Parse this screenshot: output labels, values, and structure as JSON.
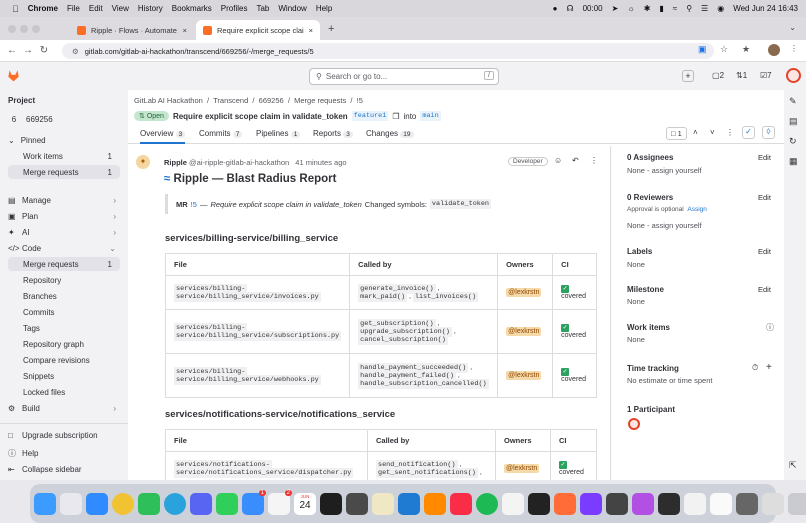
{
  "mac": {
    "app": "Chrome",
    "menus": [
      "File",
      "Edit",
      "View",
      "History",
      "Bookmarks",
      "Profiles",
      "Tab",
      "Window",
      "Help"
    ],
    "timer": "00:00",
    "datetime": "Wed Jun 24  16:43"
  },
  "tabs": [
    {
      "title": "Ripple · Flows · Automate · Gi"
    },
    {
      "title": "Require explicit scope claim"
    }
  ],
  "url": "gitlab.com/gitlab-ai-hackathon/transcend/669256/-/merge_requests/5",
  "topbar": {
    "search_placeholder": "Search or go to...",
    "slash": "/",
    "issues_count": "2",
    "mr_count": "1",
    "todo_count": "7"
  },
  "sidebar": {
    "project_heading": "Project",
    "project_avatar": "6",
    "project_name": "669256",
    "pinned": "Pinned",
    "pinned_items": [
      {
        "label": "Work items",
        "count": "1"
      },
      {
        "label": "Merge requests",
        "count": "1"
      }
    ],
    "sections": [
      "Manage",
      "Plan",
      "AI",
      "Code"
    ],
    "code_items": [
      {
        "label": "Merge requests",
        "count": "1"
      },
      {
        "label": "Repository"
      },
      {
        "label": "Branches"
      },
      {
        "label": "Commits"
      },
      {
        "label": "Tags"
      },
      {
        "label": "Repository graph"
      },
      {
        "label": "Compare revisions"
      },
      {
        "label": "Snippets"
      },
      {
        "label": "Locked files"
      }
    ],
    "build": "Build",
    "upgrade": "Upgrade subscription",
    "help": "Help",
    "collapse": "Collapse sidebar"
  },
  "breadcrumb": [
    "GitLab AI Hackathon",
    "Transcend",
    "669256",
    "Merge requests",
    "!5"
  ],
  "mr": {
    "status": "Open",
    "title": "Require explicit scope claim in validate_token",
    "source_branch": "feature1",
    "into": "into",
    "target_branch": "main",
    "tabs": [
      {
        "label": "Overview",
        "count": "3"
      },
      {
        "label": "Commits",
        "count": "7"
      },
      {
        "label": "Pipelines",
        "count": "1"
      },
      {
        "label": "Reports",
        "count": "3"
      },
      {
        "label": "Changes",
        "count": "19"
      }
    ],
    "comments_count": "1"
  },
  "note": {
    "author": "Ripple",
    "handle": "@ai-ripple-gitlab-ai-hackathon",
    "time": "41 minutes ago",
    "badge": "Developer",
    "heading": "Ripple — Blast Radius Report",
    "quote_mr": "MR",
    "quote_ref": "!5",
    "quote_dash": "—",
    "quote_title": "Require explicit scope claim in validate_token",
    "quote_changed": "Changed symbols:",
    "quote_symbol": "validate_token",
    "sections": [
      {
        "heading": "services/billing-service/billing_service",
        "columns": [
          "File",
          "Called by",
          "Owners",
          "CI"
        ],
        "rows": [
          {
            "file1": "services/billing-",
            "file2": "service/billing_service/invoices.py",
            "calls": [
              "generate_invoice()",
              "mark_paid()",
              "list_invoices()"
            ],
            "owner": "@lexkrstn",
            "ci": "covered"
          },
          {
            "file1": "services/billing-",
            "file2": "service/billing_service/subscriptions.py",
            "calls": [
              "get_subscription()",
              "upgrade_subscription()",
              "cancel_subscription()"
            ],
            "owner": "@lexkrstn",
            "ci": "covered"
          },
          {
            "file1": "services/billing-",
            "file2": "service/billing_service/webhooks.py",
            "calls": [
              "handle_payment_succeeded()",
              "handle_payment_failed()",
              "handle_subscription_cancelled()"
            ],
            "owner": "@lexkrstn",
            "ci": "covered"
          }
        ]
      },
      {
        "heading": "services/notifications-service/notifications_service",
        "columns": [
          "File",
          "Called by",
          "Owners",
          "CI"
        ],
        "rows": [
          {
            "file1": "services/notifications-",
            "file2": "service/notifications_service/dispatcher.py",
            "calls": [
              "send_notification()",
              "get_sent_notifications()"
            ],
            "owner": "@lexkrstn",
            "ci": "covered"
          }
        ]
      }
    ]
  },
  "right": {
    "assignees": "0 Assignees",
    "assignees_none": "None - assign yourself",
    "reviewers": "0 Reviewers",
    "approval": "Approval is optional",
    "assign": "Assign",
    "reviewers_none": "None - assign yourself",
    "labels": "Labels",
    "labels_none": "None",
    "milestone": "Milestone",
    "milestone_none": "None",
    "work_items": "Work items",
    "work_items_none": "None",
    "time_tracking": "Time tracking",
    "time_none": "No estimate or time spent",
    "participants": "1 Participant",
    "edit": "Edit"
  },
  "dock": {
    "calendar_day": "24",
    "calendar_month": "JUN",
    "mail_badge": "1",
    "notes_badge": "2"
  }
}
